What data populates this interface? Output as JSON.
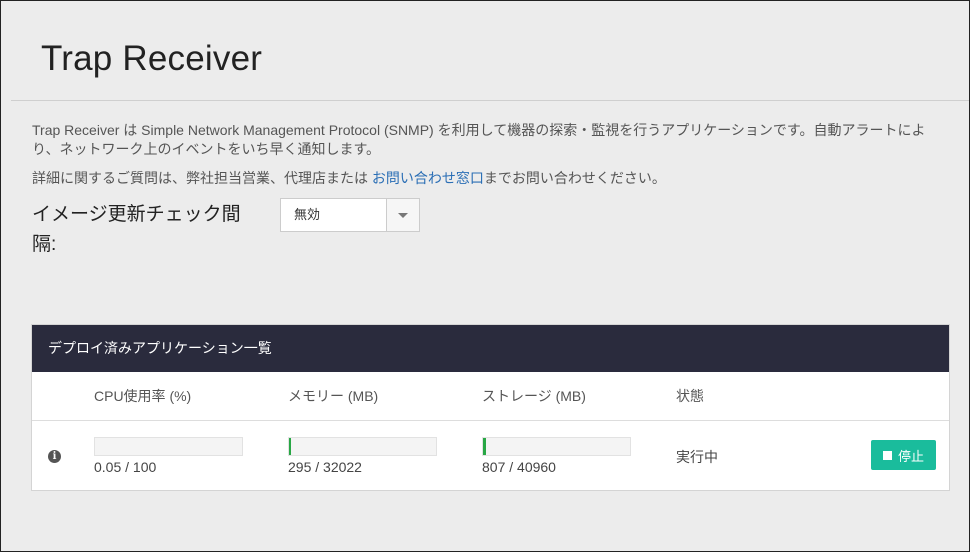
{
  "page": {
    "title": "Trap Receiver",
    "description": "Trap Receiver は Simple Network Management Protocol (SNMP) を利用して機器の探索・監視を行うアプリケーションです。自動アラートにより、ネットワーク上のイベントをいち早く通知します。",
    "contact_prefix": "詳細に関するご質問は、弊社担当営業、代理店または ",
    "contact_link": "お問い合わせ窓口",
    "contact_suffix": "までお問い合わせください。"
  },
  "image_check": {
    "label": "イメージ更新チェック間隔:",
    "selected": "無効"
  },
  "deployed_apps": {
    "title": "デプロイ済みアプリケーション一覧",
    "columns": {
      "cpu": "CPU使用率 (%)",
      "memory": "メモリー (MB)",
      "storage": "ストレージ (MB)",
      "status": "状態"
    },
    "rows": [
      {
        "cpu_usage": "0.05 / 100",
        "cpu_fraction": 0.0005,
        "memory_usage": "295 / 32022",
        "memory_fraction": 0.0092,
        "storage_usage": "807 / 40960",
        "storage_fraction": 0.0197,
        "status": "実行中",
        "stop_label": "停止",
        "info_icon": "info-icon"
      }
    ]
  },
  "colors": {
    "panel_header_bg": "#2a2b3d",
    "stop_button": "#1abc9c",
    "bar_fill": "#28a745",
    "link": "#2a6eb5"
  }
}
